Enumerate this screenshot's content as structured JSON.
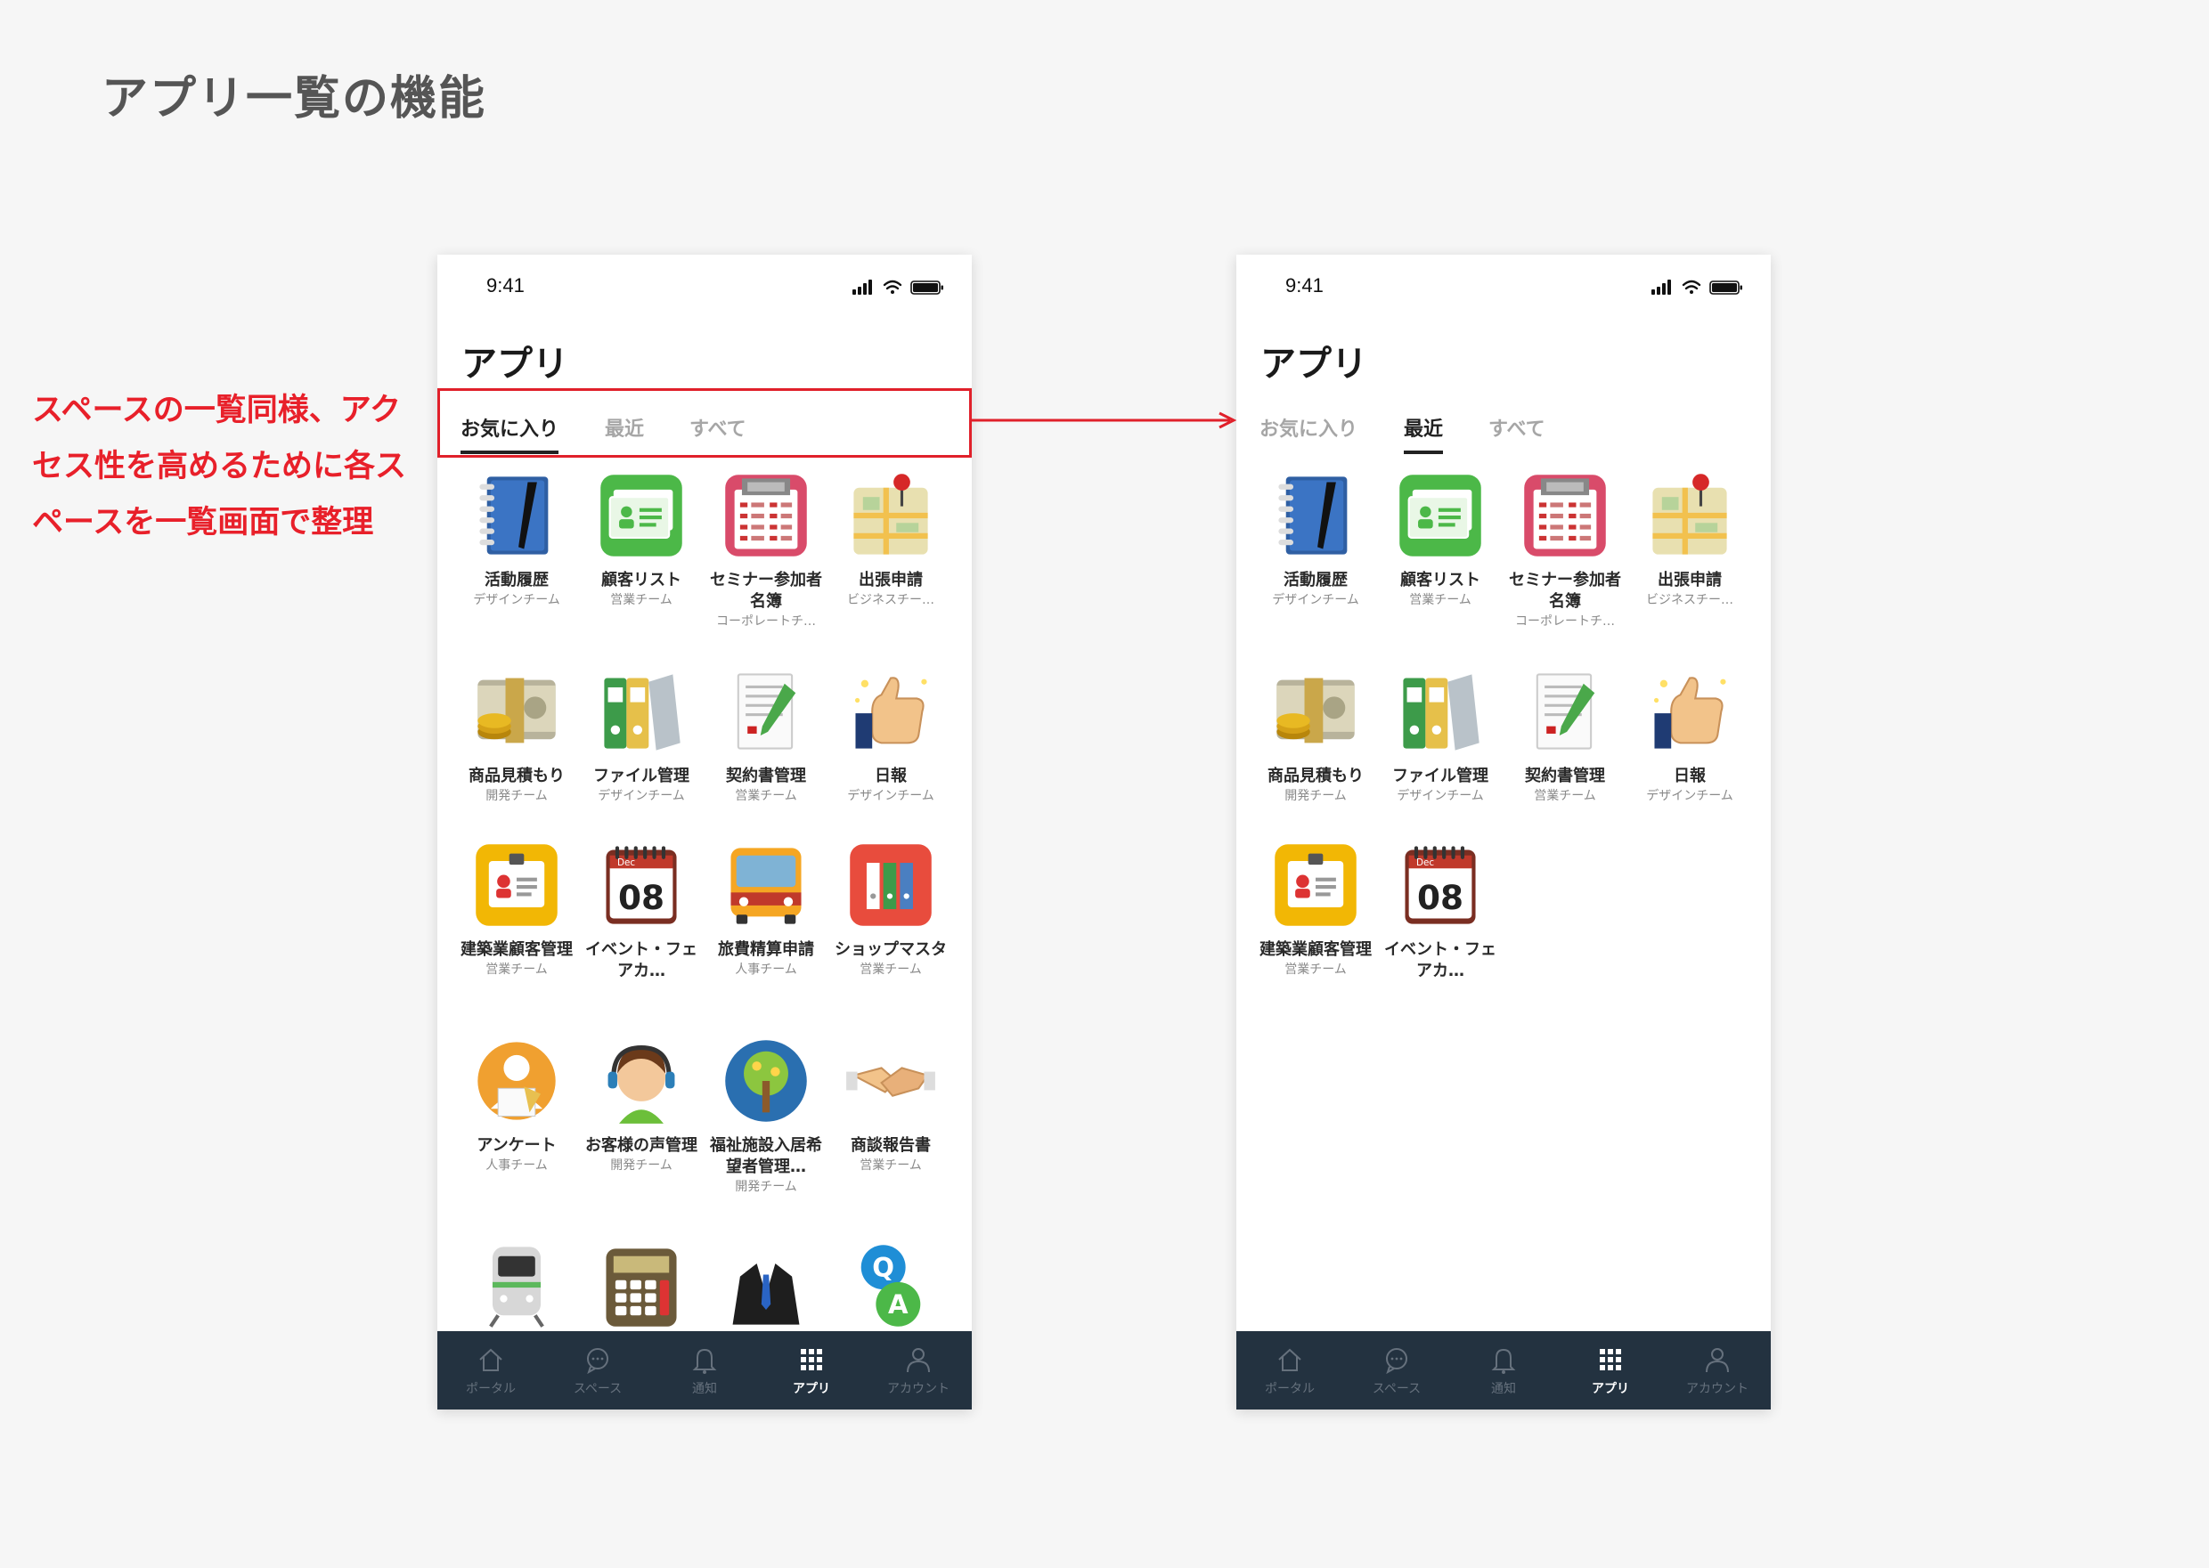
{
  "page": {
    "title": "アプリ一覧の機能"
  },
  "annotation": {
    "lines": [
      "スペースの一覧同様、アク",
      "セス性を高めるために各ス",
      "ペースを一覧画面で整理"
    ],
    "color": "#e8202a"
  },
  "phone_left": {
    "status_time": "9:41",
    "title": "アプリ",
    "tabs": [
      {
        "label": "お気に入り",
        "active": true
      },
      {
        "label": "最近",
        "active": false
      },
      {
        "label": "すべて",
        "active": false
      }
    ],
    "apps": [
      {
        "name": "活動履歴",
        "team": "デザインチーム",
        "icon": "notebook-pen-icon"
      },
      {
        "name": "顧客リスト",
        "team": "営業チーム",
        "icon": "contact-card-icon"
      },
      {
        "name": "セミナー参加者名簿",
        "team": "コーポレートチ…",
        "icon": "registry-list-icon"
      },
      {
        "name": "出張申請",
        "team": "ビジネスチー…",
        "icon": "map-pin-icon"
      },
      {
        "name": "商品見積もり",
        "team": "開発チーム",
        "icon": "cash-coins-icon"
      },
      {
        "name": "ファイル管理",
        "team": "デザインチーム",
        "icon": "binders-icon"
      },
      {
        "name": "契約書管理",
        "team": "営業チーム",
        "icon": "contract-pen-icon"
      },
      {
        "name": "日報",
        "team": "デザインチーム",
        "icon": "thumbs-up-icon"
      },
      {
        "name": "建築業顧客管理",
        "team": "営業チーム",
        "icon": "id-badge-icon"
      },
      {
        "name": "イベント・フェアカ…",
        "team": "",
        "icon": "calendar-icon",
        "cal_month": "Dec",
        "cal_day": "08"
      },
      {
        "name": "旅費精算申請",
        "team": "人事チーム",
        "icon": "bus-icon"
      },
      {
        "name": "ショップマスタ",
        "team": "営業チーム",
        "icon": "red-binders-icon"
      },
      {
        "name": "アンケート",
        "team": "人事チーム",
        "icon": "survey-person-icon"
      },
      {
        "name": "お客様の声管理",
        "team": "開発チーム",
        "icon": "headset-operator-icon"
      },
      {
        "name": "福祉施設入居希望者管理…",
        "team": "開発チーム",
        "icon": "tree-icon"
      },
      {
        "name": "商談報告書",
        "team": "営業チーム",
        "icon": "handshake-icon"
      },
      {
        "name": "",
        "team": "",
        "icon": "train-icon"
      },
      {
        "name": "",
        "team": "",
        "icon": "calculator-icon"
      },
      {
        "name": "",
        "team": "",
        "icon": "suit-icon"
      },
      {
        "name": "",
        "team": "",
        "icon": "qa-icon",
        "q": "Q",
        "a": "A"
      }
    ]
  },
  "phone_right": {
    "status_time": "9:41",
    "title": "アプリ",
    "tabs": [
      {
        "label": "お気に入り",
        "active": false
      },
      {
        "label": "最近",
        "active": true
      },
      {
        "label": "すべて",
        "active": false
      }
    ],
    "apps": [
      {
        "name": "活動履歴",
        "team": "デザインチーム",
        "icon": "notebook-pen-icon"
      },
      {
        "name": "顧客リスト",
        "team": "営業チーム",
        "icon": "contact-card-icon"
      },
      {
        "name": "セミナー参加者名簿",
        "team": "コーポレートチ…",
        "icon": "registry-list-icon"
      },
      {
        "name": "出張申請",
        "team": "ビジネスチー…",
        "icon": "map-pin-icon"
      },
      {
        "name": "商品見積もり",
        "team": "開発チーム",
        "icon": "cash-coins-icon"
      },
      {
        "name": "ファイル管理",
        "team": "デザインチーム",
        "icon": "binders-icon"
      },
      {
        "name": "契約書管理",
        "team": "営業チーム",
        "icon": "contract-pen-icon"
      },
      {
        "name": "日報",
        "team": "デザインチーム",
        "icon": "thumbs-up-icon"
      },
      {
        "name": "建築業顧客管理",
        "team": "営業チーム",
        "icon": "id-badge-icon"
      },
      {
        "name": "イベント・フェアカ…",
        "team": "",
        "icon": "calendar-icon",
        "cal_month": "Dec",
        "cal_day": "08"
      }
    ]
  },
  "tabbar": {
    "items": [
      {
        "label": "ポータル",
        "icon": "home-icon",
        "active": false
      },
      {
        "label": "スペース",
        "icon": "chat-bubble-icon",
        "active": false
      },
      {
        "label": "通知",
        "icon": "bell-icon",
        "active": false
      },
      {
        "label": "アプリ",
        "icon": "grid-icon",
        "active": true
      },
      {
        "label": "アカウント",
        "icon": "user-icon",
        "active": false
      }
    ],
    "background": "#233240"
  }
}
